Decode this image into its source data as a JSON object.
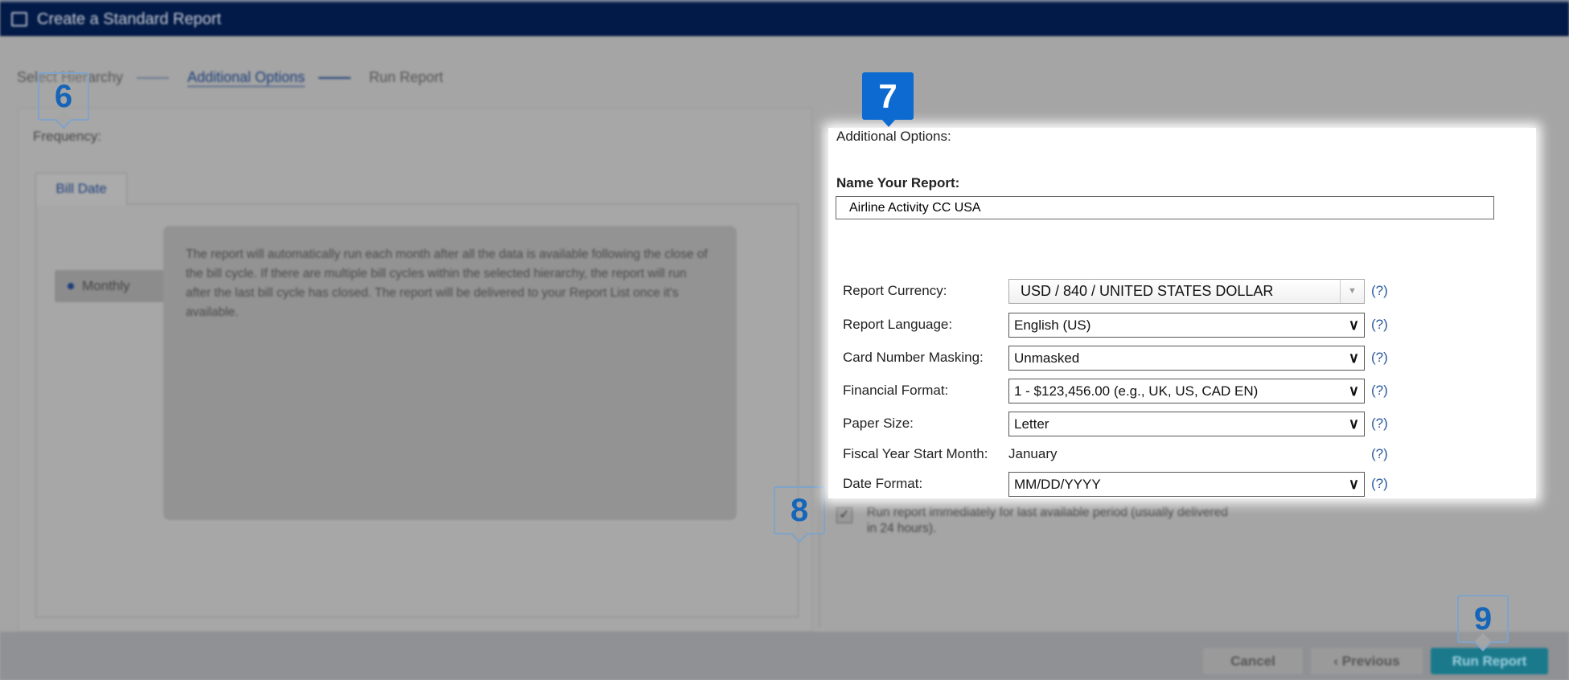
{
  "window": {
    "title": "Create a Standard Report"
  },
  "steps": [
    {
      "label": "Select Hierarchy"
    },
    {
      "label": "Additional Options"
    },
    {
      "label": "Run Report"
    }
  ],
  "left": {
    "frequency_label": "Frequency:",
    "tab": "Bill Date",
    "monthly_option": "Monthly",
    "info": "The report will automatically run each month after all the data is available following the close of the bill cycle. If there are multiple bill cycles within the selected hierarchy, the report will run after the last bill cycle has closed. The report will be delivered to your Report List once it's available."
  },
  "right": {
    "section_label": "Additional Options:",
    "name_label": "Name Your Report:",
    "name_value": "Airline Activity CC USA",
    "help": "(?)",
    "fields": [
      {
        "label": "Report Currency:",
        "value": "USD / 840 / UNITED STATES DOLLAR"
      },
      {
        "label": "Report Language:",
        "value": "English (US)"
      },
      {
        "label": "Card Number Masking:",
        "value": "Unmasked"
      },
      {
        "label": "Financial Format:",
        "value": "1 - $123,456.00 (e.g., UK, US, CAD EN)"
      },
      {
        "label": "Paper Size:",
        "value": "Letter"
      },
      {
        "label": "Fiscal Year Start Month:",
        "value": "January"
      },
      {
        "label": "Date Format:",
        "value": "MM/DD/YYYY"
      }
    ],
    "run_immediately": "Run report immediately for last available period (usually delivered in 24 hours).",
    "run_immediately_checked": true
  },
  "buttons": {
    "cancel": "Cancel",
    "previous": "‹ Previous",
    "run": "Run Report"
  },
  "badges": {
    "b6": "6",
    "b7": "7",
    "b8": "8",
    "b9": "9"
  },
  "colors": {
    "header": "#021a47",
    "badge_active": "#0c6ad0",
    "run_button": "#1a7a8c"
  }
}
